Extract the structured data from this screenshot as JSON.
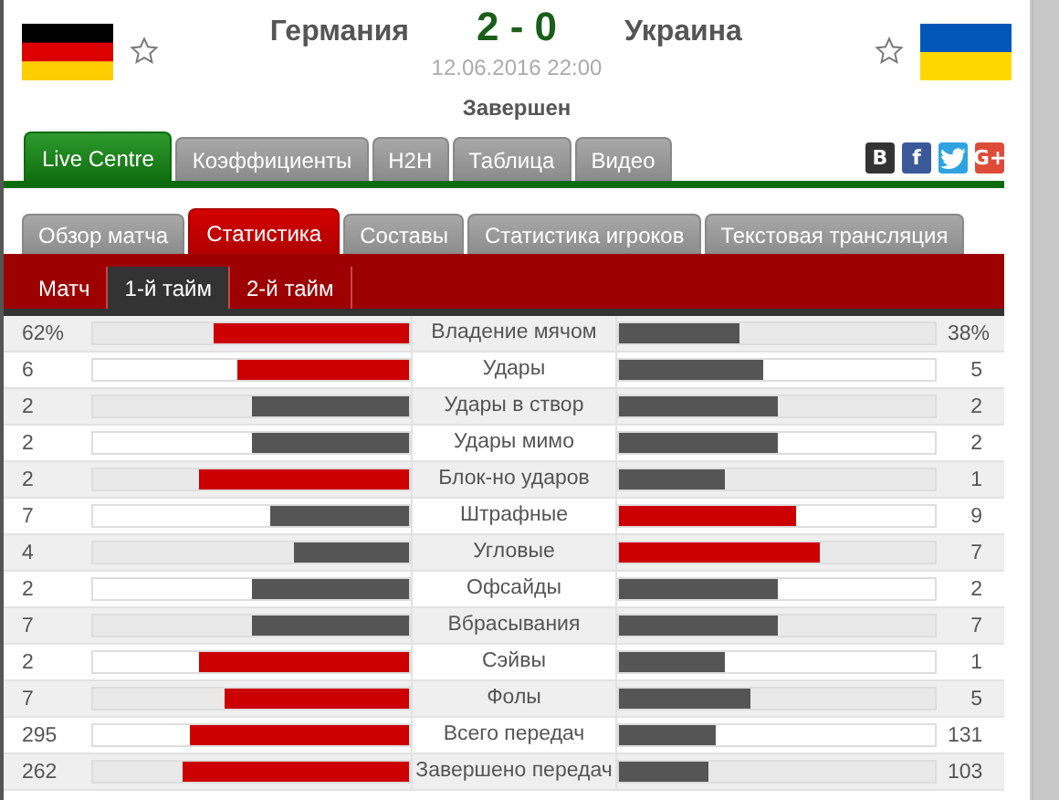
{
  "match": {
    "home": {
      "name": "Германия",
      "flag": {
        "kind": "germany"
      },
      "favorite": false
    },
    "score": "2 - 0",
    "away": {
      "name": "Украина",
      "flag": {
        "kind": "ukraine"
      },
      "favorite": false
    },
    "datetime": "12.06.2016 22:00",
    "status": "Завершен"
  },
  "main_tabs": [
    {
      "label": "Live Centre",
      "selected": true
    },
    {
      "label": "Коэффициенты",
      "selected": false
    },
    {
      "label": "H2H",
      "selected": false
    },
    {
      "label": "Таблица",
      "selected": false
    },
    {
      "label": "Видео",
      "selected": false
    }
  ],
  "share_buttons": [
    {
      "kind": "vk",
      "label": "В"
    },
    {
      "kind": "facebook",
      "label": "f"
    },
    {
      "kind": "twitter"
    },
    {
      "kind": "google",
      "label": "G+"
    }
  ],
  "section_tabs": [
    {
      "label": "Обзор матча",
      "selected": false
    },
    {
      "label": "Статистика",
      "selected": true
    },
    {
      "label": "Составы",
      "selected": false
    },
    {
      "label": "Статистика игроков",
      "selected": false
    },
    {
      "label": "Текстовая трансляция",
      "selected": false
    }
  ],
  "period_tabs": [
    {
      "label": "Матч",
      "selected": false
    },
    {
      "label": "1-й тайм",
      "selected": true
    },
    {
      "label": "2-й тайм",
      "selected": false
    }
  ],
  "stats": [
    {
      "label": "Владение мячом",
      "home": {
        "value": "62%",
        "level": 0.62,
        "leading": true
      },
      "away": {
        "value": "38%",
        "level": 0.38,
        "leading": false
      }
    },
    {
      "label": "Удары",
      "home": {
        "value": "6",
        "level": 0.545,
        "leading": true
      },
      "away": {
        "value": "5",
        "level": 0.455,
        "leading": false
      }
    },
    {
      "label": "Удары в створ",
      "home": {
        "value": "2",
        "level": 0.5,
        "leading": false
      },
      "away": {
        "value": "2",
        "level": 0.5,
        "leading": false
      }
    },
    {
      "label": "Удары мимо",
      "home": {
        "value": "2",
        "level": 0.5,
        "leading": false
      },
      "away": {
        "value": "2",
        "level": 0.5,
        "leading": false
      }
    },
    {
      "label": "Блок-но ударов",
      "home": {
        "value": "2",
        "level": 0.667,
        "leading": true
      },
      "away": {
        "value": "1",
        "level": 0.333,
        "leading": false
      }
    },
    {
      "label": "Штрафные",
      "home": {
        "value": "7",
        "level": 0.4375,
        "leading": false
      },
      "away": {
        "value": "9",
        "level": 0.5625,
        "leading": true
      }
    },
    {
      "label": "Угловые",
      "home": {
        "value": "4",
        "level": 0.364,
        "leading": false
      },
      "away": {
        "value": "7",
        "level": 0.636,
        "leading": true
      }
    },
    {
      "label": "Офсайды",
      "home": {
        "value": "2",
        "level": 0.5,
        "leading": false
      },
      "away": {
        "value": "2",
        "level": 0.5,
        "leading": false
      }
    },
    {
      "label": "Вбрасывания",
      "home": {
        "value": "7",
        "level": 0.5,
        "leading": false
      },
      "away": {
        "value": "7",
        "level": 0.5,
        "leading": false
      }
    },
    {
      "label": "Сэйвы",
      "home": {
        "value": "2",
        "level": 0.667,
        "leading": true
      },
      "away": {
        "value": "1",
        "level": 0.333,
        "leading": false
      }
    },
    {
      "label": "Фолы",
      "home": {
        "value": "7",
        "level": 0.583,
        "leading": true
      },
      "away": {
        "value": "5",
        "level": 0.417,
        "leading": false
      }
    },
    {
      "label": "Всего передач",
      "home": {
        "value": "295",
        "level": 0.692,
        "leading": true
      },
      "away": {
        "value": "131",
        "level": 0.308,
        "leading": false
      }
    },
    {
      "label": "Завершено передач",
      "home": {
        "value": "262",
        "level": 0.718,
        "leading": true
      },
      "away": {
        "value": "103",
        "level": 0.282,
        "leading": false
      }
    }
  ]
}
